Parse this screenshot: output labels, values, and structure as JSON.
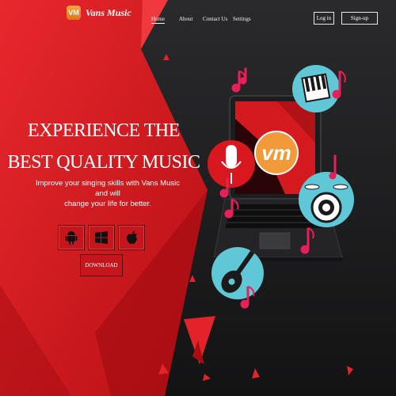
{
  "brand": {
    "logo_letters": "VM",
    "name": "Vans Music"
  },
  "nav": {
    "items": [
      {
        "label": "Home"
      },
      {
        "label": "About"
      },
      {
        "label": "Contact Us"
      },
      {
        "label": "Settings"
      }
    ],
    "login": "Log in",
    "signup": "Sign-up"
  },
  "hero": {
    "title_line1": "EXPERIENCE THE",
    "title_line2": "BEST QUALITY MUSIC",
    "subtitle_line1": "Improve your singing skills with Vans Music and will",
    "subtitle_line2": "change your life for better.",
    "stores": [
      {
        "icon": "android-icon"
      },
      {
        "icon": "windows-icon"
      },
      {
        "icon": "apple-icon"
      }
    ],
    "download_label": "DOWNLOAD"
  },
  "illustration": {
    "screen_logo": "vm"
  },
  "colors": {
    "accent_red": "#c4161c",
    "dark_bg": "#1c1c1e",
    "logo_orange": "#f09a3a",
    "bubble_teal": "#5fc7d6",
    "note_pink": "#e8205a"
  }
}
